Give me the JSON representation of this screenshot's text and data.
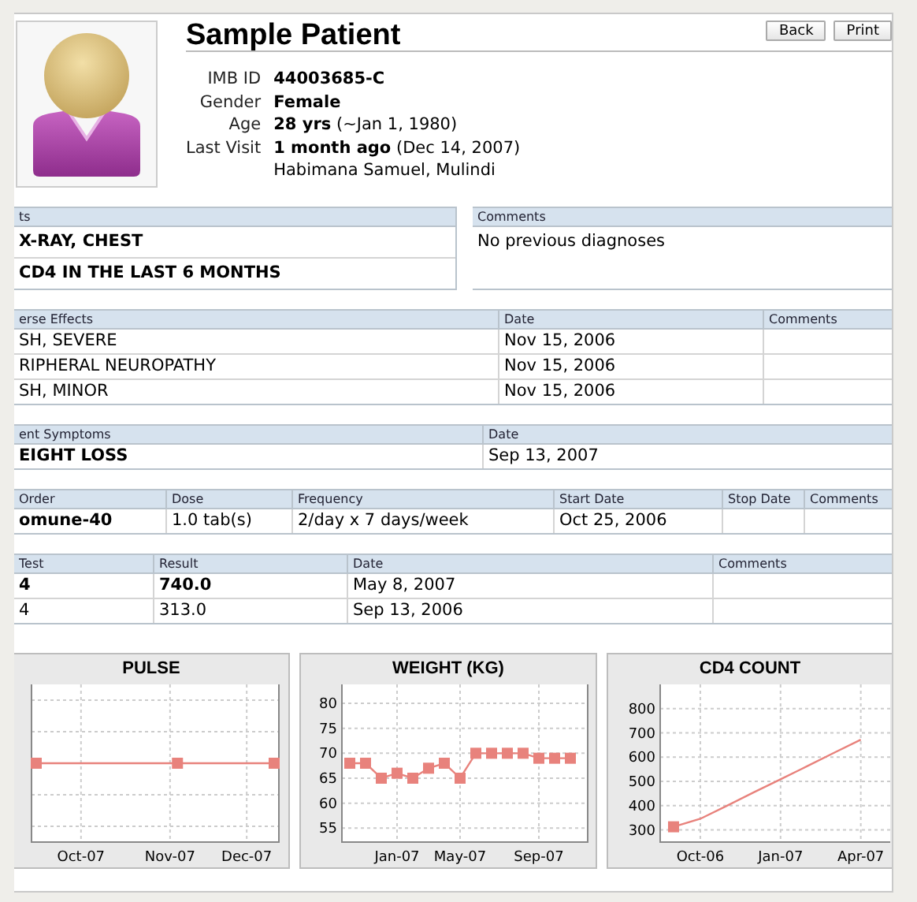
{
  "header": {
    "title": "Sample Patient",
    "buttons": [
      "Back",
      "Print"
    ],
    "fields": [
      {
        "label": "IMB ID",
        "value": "44003685-C"
      },
      {
        "label": "Gender",
        "value": "Female"
      },
      {
        "label": "Age",
        "value": "28 yrs",
        "note": "(~Jan 1, 1980)"
      },
      {
        "label": "Last Visit",
        "value": "1 month ago",
        "note": "(Dec 14, 2007)"
      },
      {
        "note": "Habimana Samuel, Mulindi"
      }
    ]
  },
  "sections": [
    {
      "tables": [
        {
          "columns": [
            "ts"
          ],
          "rows": [
            {
              "cells": [
                {
                  "text": "X-RAY, CHEST",
                  "bold": true
                }
              ]
            },
            {
              "cells": [
                {
                  "text": "CD4 IN THE LAST 6 MONTHS",
                  "bold": true
                }
              ]
            }
          ]
        },
        {
          "columns": [
            "Comments"
          ],
          "rows": [
            {
              "cells": [
                {
                  "text": "No previous diagnoses",
                  "bold": false
                }
              ]
            }
          ]
        }
      ]
    },
    {
      "tables": [
        {
          "columns": [
            "erse Effects",
            "Date",
            "Comments"
          ],
          "rows": [
            {
              "cells": [
                {
                  "text": "SH, SEVERE",
                  "bold": false
                },
                {
                  "text": "Nov 15, 2006",
                  "bold": false
                }
              ]
            },
            {
              "cells": [
                {
                  "text": "RIPHERAL NEUROPATHY",
                  "bold": false
                },
                {
                  "text": "Nov 15, 2006",
                  "bold": false
                }
              ]
            },
            {
              "cells": [
                {
                  "text": "SH, MINOR",
                  "bold": false
                },
                {
                  "text": "Nov 15, 2006",
                  "bold": false
                }
              ]
            }
          ]
        }
      ]
    },
    {
      "tables": [
        {
          "columns": [
            "ent Symptoms",
            "Date"
          ],
          "rows": [
            {
              "cells": [
                {
                  "text": "EIGHT LOSS",
                  "bold": true
                },
                {
                  "text": "Sep 13, 2007",
                  "bold": false
                }
              ]
            }
          ]
        }
      ]
    },
    {
      "tables": [
        {
          "columns": [
            "Order",
            "Dose",
            "Frequency",
            "Start Date",
            "Stop Date",
            "Comments"
          ],
          "rows": [
            {
              "cells": [
                {
                  "text": "omune-40",
                  "bold": true
                },
                {
                  "text": "1.0 tab(s)",
                  "bold": false
                },
                {
                  "text": "2/day x 7 days/week",
                  "bold": false
                },
                {
                  "text": "Oct 25, 2006",
                  "bold": false
                }
              ]
            }
          ]
        }
      ]
    },
    {
      "tables": [
        {
          "columns": [
            "Test",
            "Result",
            "Date",
            "Comments"
          ],
          "rows": [
            {
              "cells": [
                {
                  "text": "4",
                  "bold": true
                },
                {
                  "text": "740.0",
                  "bold": true
                },
                {
                  "text": "May 8, 2007",
                  "bold": false
                }
              ]
            },
            {
              "cells": [
                {
                  "text": "4",
                  "bold": false
                },
                {
                  "text": "313.0",
                  "bold": false
                },
                {
                  "text": "Sep 13, 2006",
                  "bold": false
                }
              ]
            }
          ]
        }
      ]
    }
  ],
  "charts": [
    {
      "kind": "picture",
      "title": "PULSE",
      "x_labels": [
        "Oct-07",
        "Nov-07",
        "Dec-07"
      ]
    },
    {
      "kind": "chart",
      "title": "WEIGHT (KG)",
      "chart_data": {
        "type": "line",
        "grid": true,
        "categories": [
          null,
          null,
          null,
          "Jan-07",
          null,
          null,
          null,
          "May-07",
          null,
          null,
          null,
          null,
          "Sep-07",
          null,
          null
        ],
        "series": [
          {
            "color": "#e8827c",
            "marker": "square",
            "values": [
              68,
              68,
              65,
              66,
              65,
              67,
              68,
              65,
              70,
              70,
              70,
              70,
              69,
              69,
              69
            ]
          }
        ],
        "ylim": [
          52.2,
          83.8
        ],
        "yticks": [
          55,
          60,
          65,
          70,
          75,
          80
        ]
      }
    },
    {
      "kind": "chart",
      "title": "CD4 COUNT",
      "chart_data": {
        "type": "line",
        "grid": true,
        "categories": [
          null,
          "Oct-06",
          null,
          null,
          "Jan-07",
          null,
          null,
          "Apr-07"
        ],
        "series": [
          {
            "color": "#e8827c",
            "marker": "none",
            "values": [
              313,
              346,
              400,
              455,
              509,
              563,
              618,
              672
            ]
          },
          {
            "color": "#e8827c",
            "marker": "square",
            "values": [
              313,
              null,
              null,
              null,
              null,
              null,
              null,
              null
            ]
          }
        ],
        "ylim": [
          250,
          900
        ],
        "yticks": [
          300,
          400,
          500,
          600,
          700,
          800
        ]
      }
    }
  ]
}
